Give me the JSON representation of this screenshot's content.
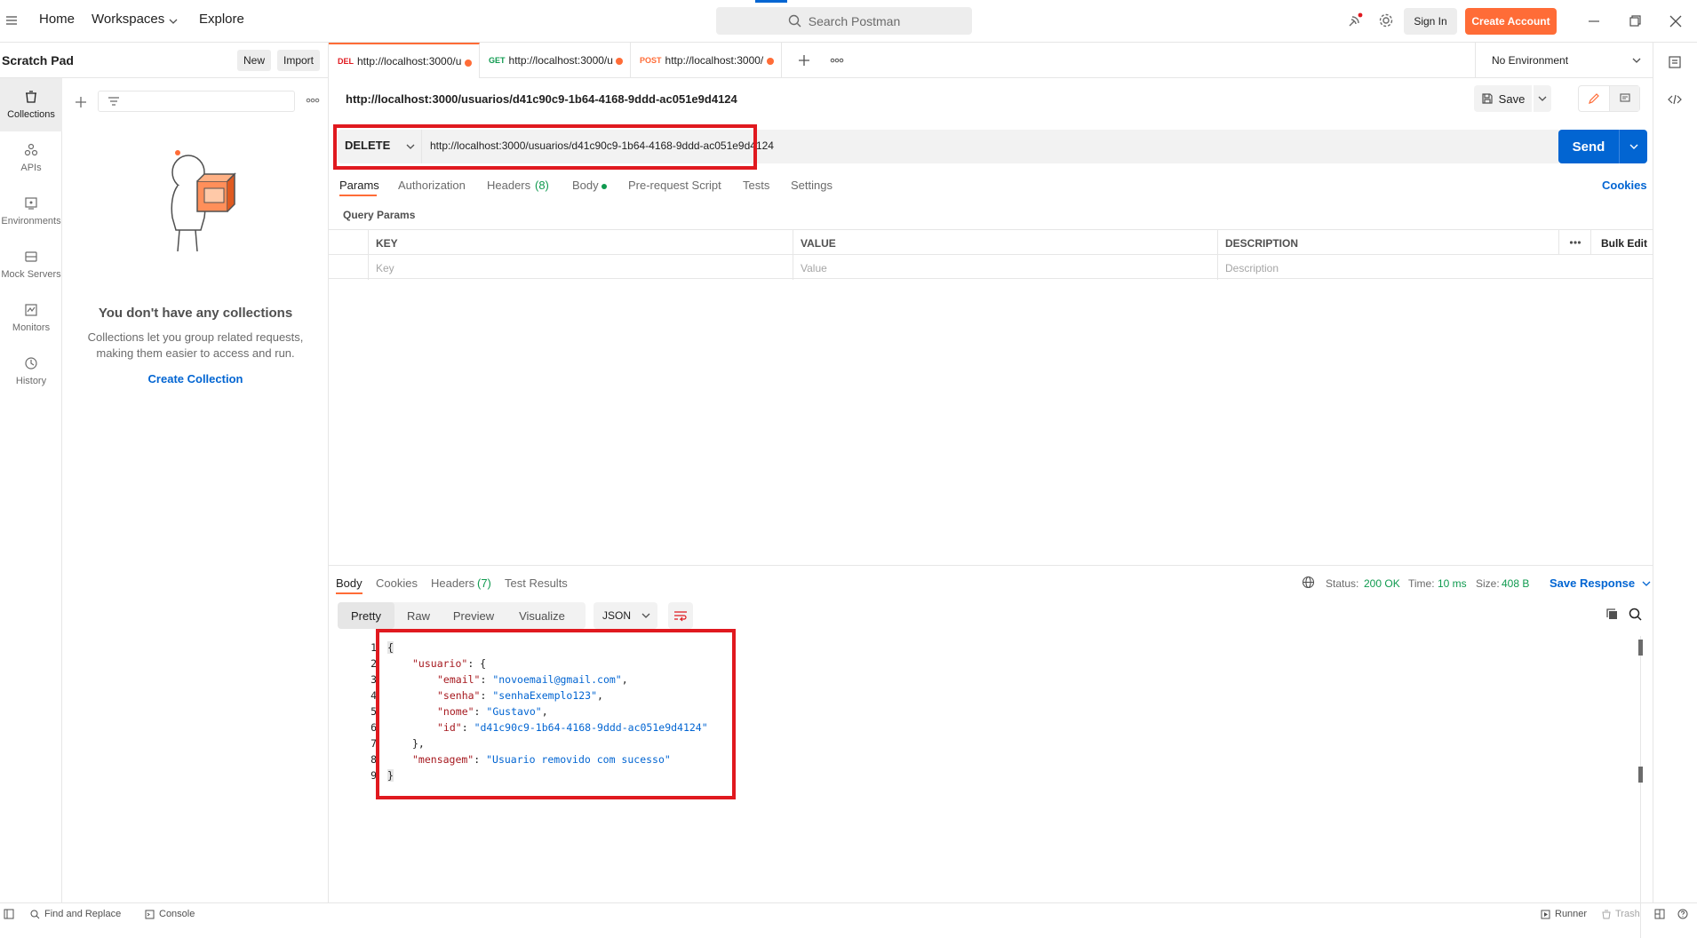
{
  "topbar": {
    "nav": [
      "Home",
      "Workspaces",
      "Explore"
    ],
    "search_placeholder": "Search Postman",
    "sign_in": "Sign In",
    "create_account": "Create Account"
  },
  "left": {
    "title": "Scratch Pad",
    "new_label": "New",
    "import_label": "Import",
    "rail": [
      "Collections",
      "APIs",
      "Environments",
      "Mock Servers",
      "Monitors",
      "History"
    ],
    "empty_title": "You don't have any collections",
    "empty_desc": "Collections let you group related requests, making them easier to access and run.",
    "create_collection": "Create Collection"
  },
  "tabs": [
    {
      "method": "DEL",
      "url": "http://localhost:3000/u",
      "color": "#e0191f"
    },
    {
      "method": "GET",
      "url": "http://localhost:3000/u",
      "color": "#0f9a4f"
    },
    {
      "method": "POST",
      "url": "http://localhost:3000/",
      "color": "#ff6c37"
    }
  ],
  "environment": "No Environment",
  "request": {
    "title": "http://localhost:3000/usuarios/d41c90c9-1b64-4168-9ddd-ac051e9d4124",
    "save_label": "Save",
    "method": "DELETE",
    "url": "http://localhost:3000/usuarios/d41c90c9-1b64-4168-9ddd-ac051e9d4124",
    "send_label": "Send",
    "subtabs": [
      "Params",
      "Authorization",
      "Headers",
      "(8)",
      "Body",
      "Pre-request Script",
      "Tests",
      "Settings"
    ],
    "cookies": "Cookies",
    "query_params": "Query Params",
    "columns": [
      "KEY",
      "VALUE",
      "DESCRIPTION"
    ],
    "bulk_edit": "Bulk Edit",
    "placeholders": [
      "Key",
      "Value",
      "Description"
    ]
  },
  "response": {
    "tabs": [
      "Body",
      "Cookies",
      "Headers",
      "(7)",
      "Test Results"
    ],
    "status_label": "Status:",
    "status_value": "200 OK",
    "time_label": "Time:",
    "time_value": "10 ms",
    "size_label": "Size:",
    "size_value": "408 B",
    "save_response": "Save Response",
    "views": [
      "Pretty",
      "Raw",
      "Preview",
      "Visualize"
    ],
    "format": "JSON",
    "lines": [
      "1",
      "2",
      "3",
      "4",
      "5",
      "6",
      "7",
      "8",
      "9"
    ],
    "json": {
      "open": "{",
      "usuario_key": "\"usuario\"",
      "email_key": "\"email\"",
      "email_val": "\"novoemail@gmail.com\"",
      "senha_key": "\"senha\"",
      "senha_val": "\"senhaExemplo123\"",
      "nome_key": "\"nome\"",
      "nome_val": "\"Gustavo\"",
      "id_key": "\"id\"",
      "id_val": "\"d41c90c9-1b64-4168-9ddd-ac051e9d4124\"",
      "close_inner": "},",
      "mensagem_key": "\"mensagem\"",
      "mensagem_val": "\"Usuario removido com sucesso\"",
      "close": "}"
    }
  },
  "footer": {
    "find_replace": "Find and Replace",
    "console": "Console",
    "runner": "Runner",
    "trash": "Trash"
  },
  "colors": {
    "accent": "#ff6c37",
    "primary": "#0265d2",
    "highlight": "#e0191f",
    "success": "#0f9a4f"
  }
}
